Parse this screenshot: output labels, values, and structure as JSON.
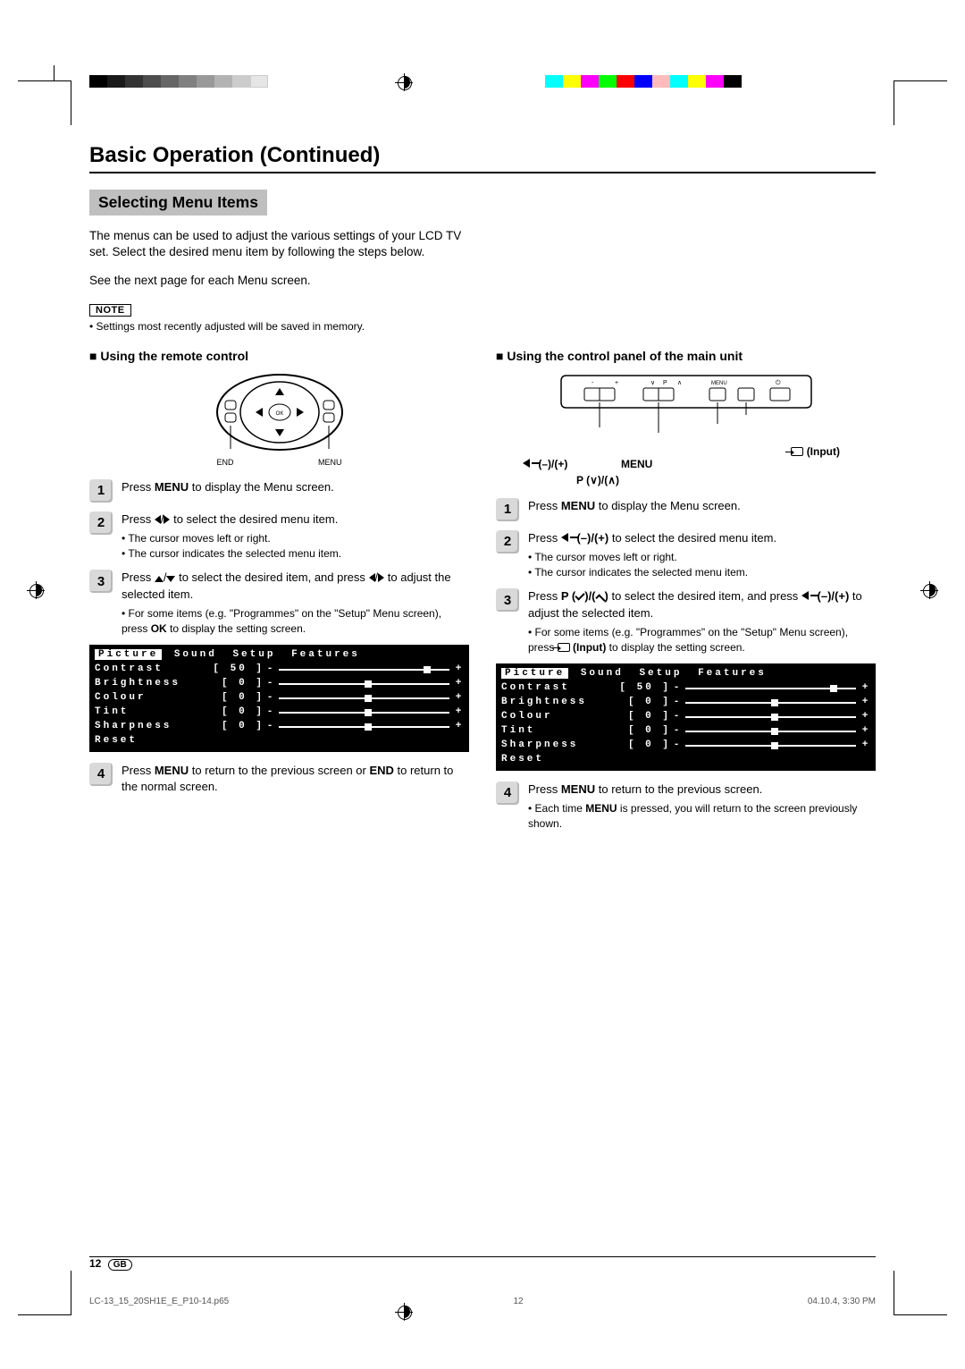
{
  "title": "Basic Operation (Continued)",
  "section": "Selecting Menu Items",
  "intro1": "The menus can be used to adjust the various settings of your LCD TV set. Select the desired menu item by following the steps below.",
  "intro2": "See the next page for each Menu screen.",
  "note_label": "NOTE",
  "note_text": "Settings most recently adjusted will be saved in memory.",
  "left": {
    "heading": "Using the remote control",
    "remote_end": "END",
    "remote_menu": "MENU",
    "remote_ok": "OK",
    "step1": "Press MENU to display the Menu screen.",
    "step2": "Press ◀/▶ to select the desired menu item.",
    "step2_b1": "The cursor moves left or right.",
    "step2_b2": "The cursor indicates the selected menu item.",
    "step3a": "Press ▲/▼ to select the desired item, and press ◀/▶ to adjust the selected item.",
    "step3_b1": "For some items (e.g. \"Programmes\" on the \"Setup\" Menu screen), press OK to display the setting screen.",
    "step4": "Press MENU to return to the previous screen or END to return to the normal screen."
  },
  "right": {
    "heading": "Using the control panel of the main unit",
    "lbl_input": "(Input)",
    "lbl_vol": "(–)/(+)",
    "lbl_menu": "MENU",
    "lbl_p": "P (∨)/(∧)",
    "step1": "Press MENU to display the Menu screen.",
    "step2a": "Press ",
    "step2b": " (–)/(+) to select the desired menu item.",
    "step2_b1": "The cursor moves left or right.",
    "step2_b2": "The cursor indicates the selected menu item.",
    "step3a": "Press P (∨)/(∧) to select the desired item, and press",
    "step3b": " (–)/(+) to adjust the selected item.",
    "step3_b1a": "For some items (e.g. \"Programmes\" on the \"Setup\" Menu screen), press ",
    "step3_b1b": " (Input) to display the setting screen.",
    "step4": "Press MENU to return to the previous screen.",
    "step4_b1": "Each time MENU is pressed, you will return to the screen previously shown."
  },
  "osd": {
    "tabs": [
      "Picture",
      "Sound",
      "Setup",
      "Features"
    ],
    "rows": [
      {
        "name": "Contrast",
        "val": "50",
        "thumb": 85
      },
      {
        "name": "Brightness",
        "val": "0",
        "thumb": 50
      },
      {
        "name": "Colour",
        "val": "0",
        "thumb": 50
      },
      {
        "name": "Tint",
        "val": "0",
        "thumb": 50
      },
      {
        "name": "Sharpness",
        "val": "0",
        "thumb": 50
      }
    ],
    "reset": "Reset"
  },
  "footer": {
    "page_num": "12",
    "lang": "GB",
    "file": "LC-13_15_20SH1E_E_P10-14.p65",
    "file_pg": "12",
    "timestamp": "04.10.4, 3:30 PM"
  }
}
